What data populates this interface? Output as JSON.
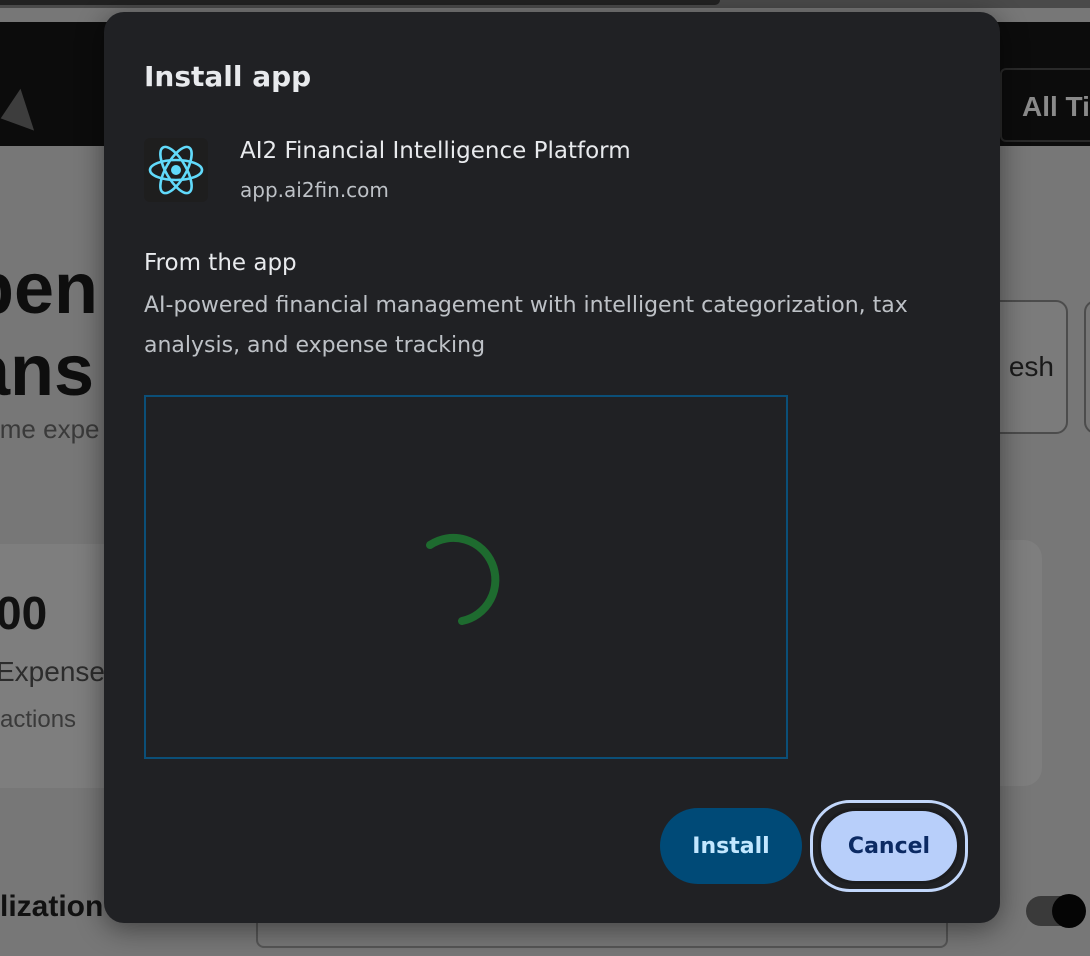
{
  "background": {
    "nav_filter": "All Ti",
    "heading_lines": [
      "pen",
      "ans"
    ],
    "subtitle": "ime expe",
    "refresh_label": "esh",
    "card_value": "00",
    "card_label": "Expense",
    "card_sub": "actions",
    "section_title": "lization"
  },
  "dialog": {
    "title": "Install app",
    "app": {
      "icon": "react-atom-icon",
      "name": "AI2 Financial Intelligence Platform",
      "url": "app.ai2fin.com"
    },
    "from_heading": "From the app",
    "description": "AI-powered financial management with intelligent categorization, tax analysis, and expense tracking",
    "preview": {
      "state": "loading",
      "spinner_color": "#1e6b2f",
      "border_color": "#0b4f78"
    },
    "buttons": {
      "install": "Install",
      "cancel": "Cancel"
    }
  },
  "colors": {
    "dialog_bg": "#202124",
    "install_bg": "#004a77",
    "cancel_bg": "#b8cffa",
    "react_icon": "#61dafb"
  }
}
